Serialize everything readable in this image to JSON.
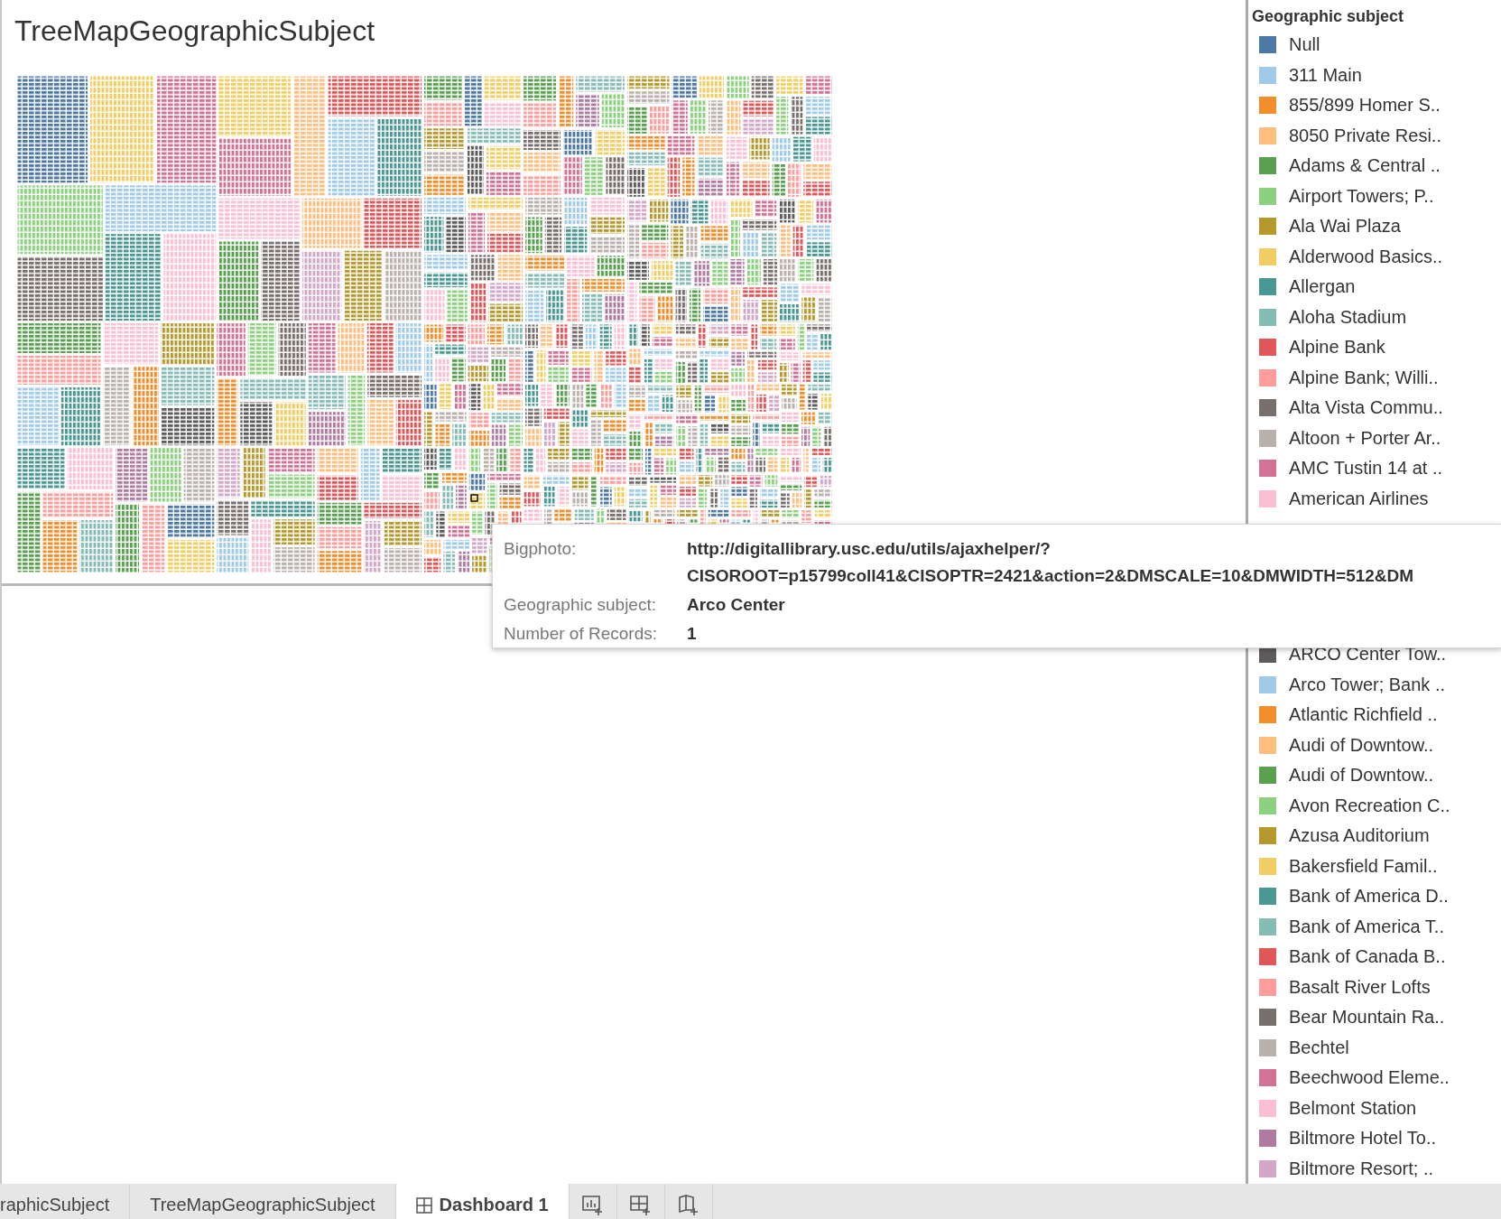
{
  "dashboard": {
    "title": "TreeMapGeographicSubject"
  },
  "legend": {
    "title": "Geographic subject",
    "items": [
      {
        "name": "Null",
        "color": "#4e79a7"
      },
      {
        "name": "311 Main",
        "color": "#a0cbe8"
      },
      {
        "name": "855/899 Homer S..",
        "color": "#f28e2b"
      },
      {
        "name": "8050 Private Resi..",
        "color": "#ffbe7d"
      },
      {
        "name": "Adams & Central ..",
        "color": "#59a14f"
      },
      {
        "name": "Airport Towers; P..",
        "color": "#8cd17d"
      },
      {
        "name": "Ala Wai Plaza",
        "color": "#b6992d"
      },
      {
        "name": "Alderwood Basics..",
        "color": "#f1ce63"
      },
      {
        "name": "Allergan",
        "color": "#499894"
      },
      {
        "name": "Aloha Stadium",
        "color": "#86bcb6"
      },
      {
        "name": "Alpine Bank",
        "color": "#e15759"
      },
      {
        "name": "Alpine Bank; Willi..",
        "color": "#ff9d9a"
      },
      {
        "name": "Alta Vista Commu..",
        "color": "#79706e"
      },
      {
        "name": "Altoon + Porter Ar..",
        "color": "#bab0ac"
      },
      {
        "name": "AMC Tustin 14 at ..",
        "color": "#d37295"
      },
      {
        "name": "American Airlines",
        "color": "#fabfd2"
      }
    ],
    "items_below": [
      {
        "name": "ARCO Center Tow..",
        "color": "#5f5c5e"
      },
      {
        "name": "Arco Tower; Bank ..",
        "color": "#a0cbe8"
      },
      {
        "name": "Atlantic Richfield ..",
        "color": "#f28e2b"
      },
      {
        "name": "Audi of Downtow..",
        "color": "#ffbe7d"
      },
      {
        "name": "Audi of Downtow..",
        "color": "#59a14f"
      },
      {
        "name": "Avon Recreation C..",
        "color": "#8cd17d"
      },
      {
        "name": "Azusa Auditorium",
        "color": "#b6992d"
      },
      {
        "name": "Bakersfield Famil..",
        "color": "#f1ce63"
      },
      {
        "name": "Bank of America D..",
        "color": "#499894"
      },
      {
        "name": "Bank of America T..",
        "color": "#86bcb6"
      },
      {
        "name": "Bank of Canada B..",
        "color": "#e15759"
      },
      {
        "name": "Basalt River Lofts",
        "color": "#ff9d9a"
      },
      {
        "name": "Bear Mountain Ra..",
        "color": "#79706e"
      },
      {
        "name": "Bechtel",
        "color": "#bab0ac"
      },
      {
        "name": "Beechwood Eleme..",
        "color": "#d37295"
      },
      {
        "name": "Belmont Station",
        "color": "#fabfd2"
      },
      {
        "name": "Biltmore Hotel To..",
        "color": "#b07aa1"
      },
      {
        "name": "Biltmore Resort; ..",
        "color": "#d4a6c8"
      }
    ]
  },
  "tooltip": {
    "rows": [
      {
        "label": "Bigphoto:",
        "values": [
          "http://digitallibrary.usc.edu/utils/ajaxhelper/?",
          "CISOROOT=p15799coll41&CISOPTR=2421&action=2&DMSCALE=10&DMWIDTH=512&DM"
        ]
      },
      {
        "label": "Geographic subject:",
        "values": [
          "Arco Center"
        ]
      },
      {
        "label": "Number of Records:",
        "values": [
          "1"
        ]
      }
    ]
  },
  "tabs": [
    {
      "label": "raphicSubject",
      "kind": "sheet",
      "selected": false
    },
    {
      "label": "TreeMapGeographicSubject",
      "kind": "sheet",
      "selected": false
    },
    {
      "label": "Dashboard 1",
      "kind": "dashboard",
      "selected": true
    }
  ],
  "actions": [
    {
      "kind": "new-worksheet"
    },
    {
      "kind": "new-dashboard"
    },
    {
      "kind": "new-story"
    }
  ]
}
